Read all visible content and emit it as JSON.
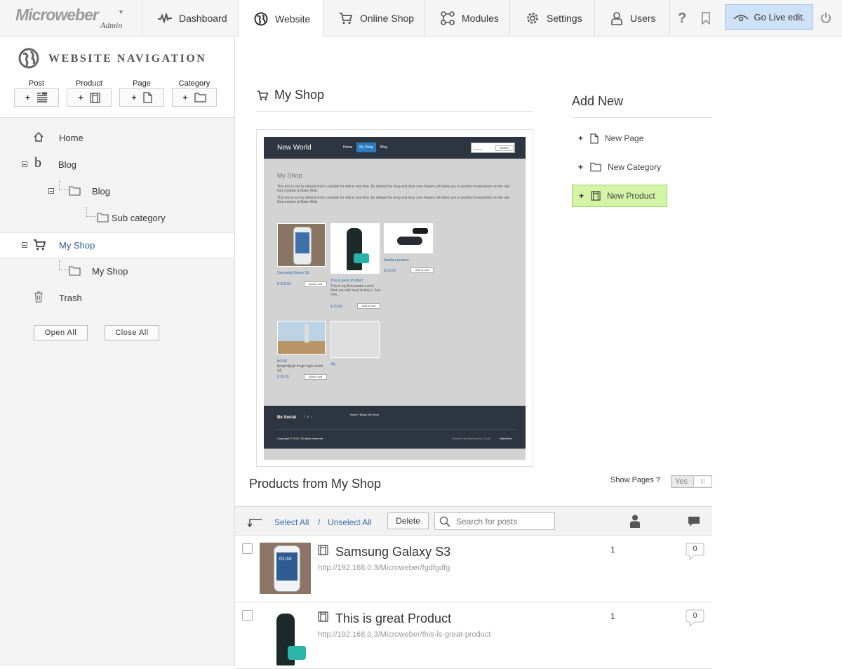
{
  "app": {
    "brand": "Microweber",
    "sub": "Admin"
  },
  "nav": {
    "dashboard": "Dashboard",
    "website": "Website",
    "shop": "Online Shop",
    "modules": "Modules",
    "settings": "Settings",
    "users": "Users",
    "go_live": "Go Live edit."
  },
  "sidebar": {
    "title": "WEBSITE NAVIGATION",
    "quick": [
      "Post",
      "Product",
      "Page",
      "Category"
    ],
    "tree": {
      "home": "Home",
      "blog": "Blog",
      "blog_cat": "Blog",
      "subcat": "Sub category",
      "myshop": "My Shop",
      "myshop_cat": "My Shop",
      "trash": "Trash"
    },
    "open_all": "Open All",
    "close_all": "Close All"
  },
  "main": {
    "page_title": "My Shop",
    "add_new": {
      "title": "Add New",
      "items": [
        "New Page",
        "New Category",
        "New Product"
      ]
    },
    "preview": {
      "site_name": "New World",
      "menu": [
        "Home",
        "My Shop",
        "Blog"
      ],
      "search_ph": "Search",
      "search_btn": "Search",
      "heading": "My Shop",
      "desc1": "This text is set by default and is suitable for edit in real time. By default the drag and drop core feature will allow you to position it anywhere on the site. Get creative & Make Web.",
      "desc2": "This text is set by default and is suitable for edit in real time. By default the drag and drop core feature will allow you to position it anywhere on the site. Get creative & Make Web.",
      "products": [
        {
          "name": "Samsung Galaxy S3",
          "price": "$ 320.00"
        },
        {
          "name": "This is great Product",
          "desc": "This is my first product and i think you will need to buy it. See how...",
          "price": "$ 25.00"
        },
        {
          "name": "Another product",
          "price": "$ 13.00"
        },
        {
          "name": "BOOK",
          "desc": "fjsdghsfjkgh fhsgh fsgh  kbsldi  sjlj",
          "price": "$ 30.00"
        },
        {
          "name": "dfg"
        }
      ],
      "add_cart": "Add to cart",
      "be_social": "Be Social",
      "footer_links": "Home | Blog | My Shop",
      "copyright": "Copyright © 2012, All rights reserved",
      "powered": "Powered by Microweber (CMS)",
      "makeweb": "MakeWeb"
    },
    "products_title": "Products from My Shop",
    "show_pages_label": "Show Pages ?",
    "show_pages_value": "Yes",
    "toolbar": {
      "select_all": "Select All",
      "sep": "/",
      "unselect_all": "Unselect All",
      "delete": "Delete",
      "search_ph": "Search for posts"
    },
    "rows": [
      {
        "title": "Samsung Galaxy S3",
        "url": "http://192.168.0.3/Microweber/fgdfgdfg",
        "count": "1",
        "comments": "0"
      },
      {
        "title": "This is great Product",
        "url": "http://192.168.0.3/Microweber/this-is-great-product",
        "count": "1",
        "comments": "0"
      }
    ]
  }
}
